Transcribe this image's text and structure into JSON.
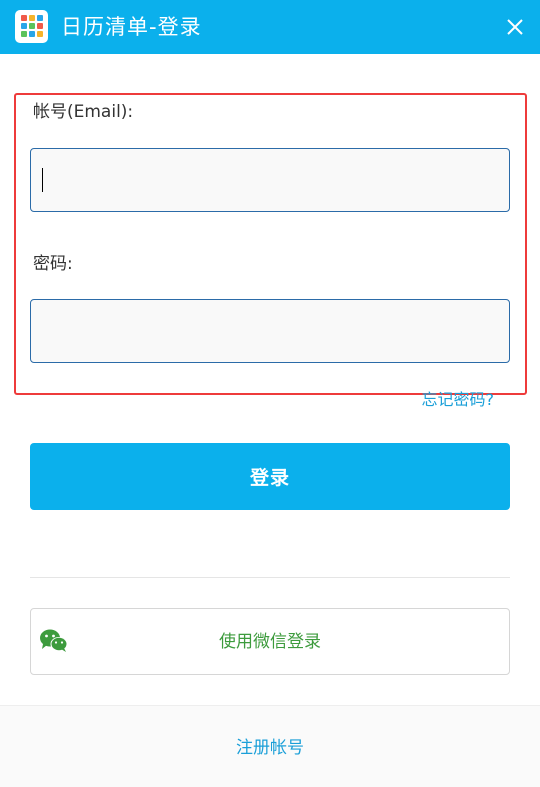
{
  "window": {
    "title": "日历清单-登录",
    "app_icon": "calendar-grid-icon",
    "close_icon": "close-icon",
    "accent_color": "#0bb0ec"
  },
  "form": {
    "email_label": "帐号(Email):",
    "email_value": "",
    "password_label": "密码:",
    "password_value": "",
    "forgot_link": "忘记密码?",
    "login_button": "登录",
    "highlight_color": "#ee3b3b"
  },
  "social": {
    "wechat_button": "使用微信登录",
    "wechat_icon": "wechat-icon",
    "wechat_color": "#3d9b3d"
  },
  "footer": {
    "register_link": "注册帐号"
  }
}
